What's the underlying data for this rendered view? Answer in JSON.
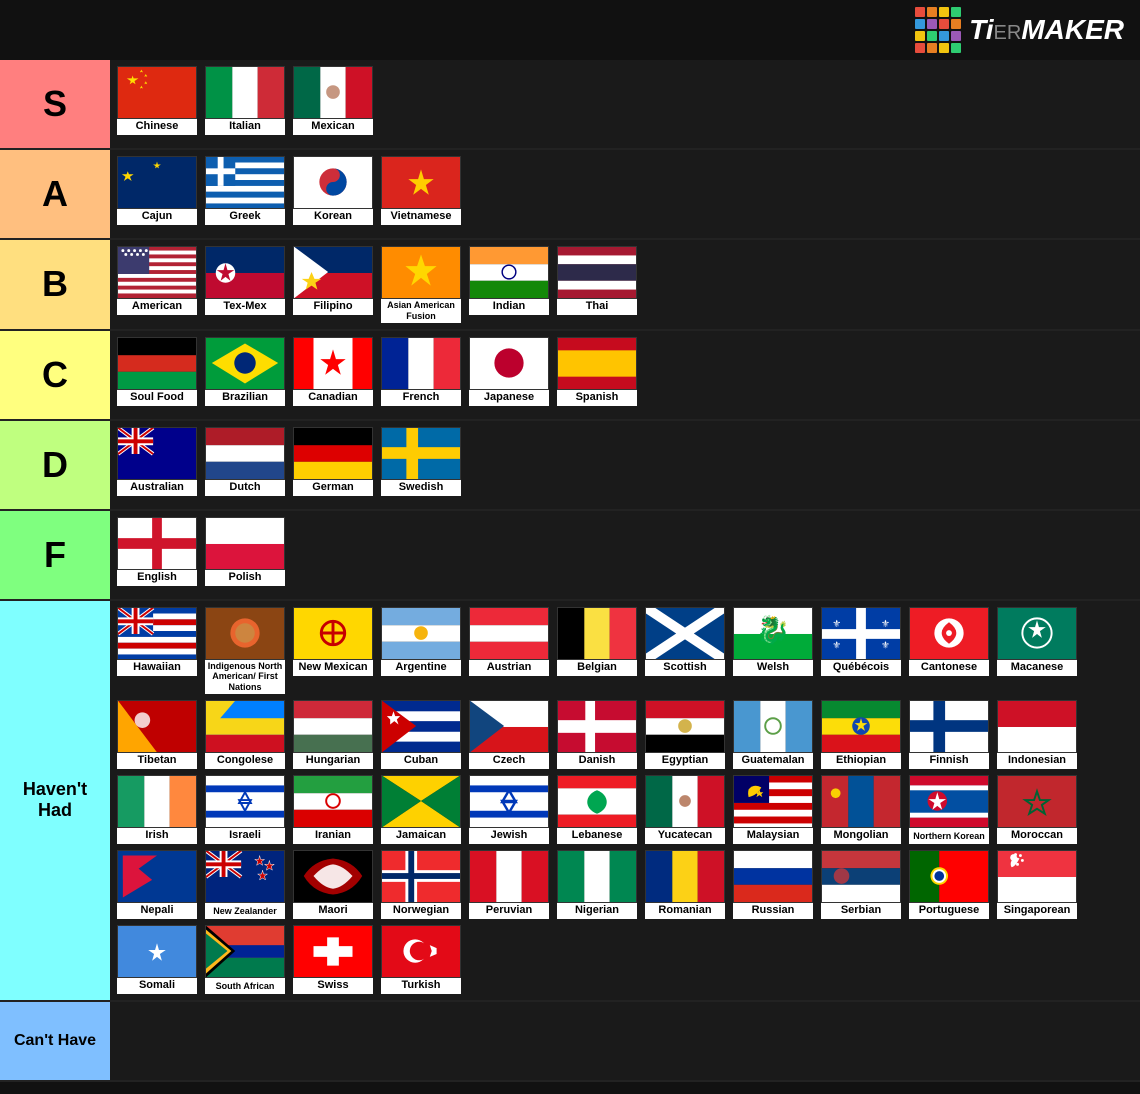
{
  "header": {
    "logo_text": "TiERMAKER"
  },
  "tiers": [
    {
      "id": "s",
      "label": "S",
      "color": "#ff7f7f",
      "items": [
        {
          "name": "Chinese",
          "flag": "china"
        },
        {
          "name": "Italian",
          "flag": "italy"
        },
        {
          "name": "Mexican",
          "flag": "mexico"
        }
      ]
    },
    {
      "id": "a",
      "label": "A",
      "color": "#ffbf7f",
      "items": [
        {
          "name": "Cajun",
          "flag": "cajun"
        },
        {
          "name": "Greek",
          "flag": "greek"
        },
        {
          "name": "Korean",
          "flag": "korean"
        },
        {
          "name": "Vietnamese",
          "flag": "vietnamese"
        }
      ]
    },
    {
      "id": "b",
      "label": "B",
      "color": "#ffdf7f",
      "items": [
        {
          "name": "American",
          "flag": "american"
        },
        {
          "name": "Tex-Mex",
          "flag": "texmex"
        },
        {
          "name": "Filipino",
          "flag": "filipino"
        },
        {
          "name": "Asian American Fusion",
          "flag": "asianfusion"
        },
        {
          "name": "Indian",
          "flag": "indian"
        },
        {
          "name": "Thai",
          "flag": "thai"
        }
      ]
    },
    {
      "id": "c",
      "label": "C",
      "color": "#ffff7f",
      "items": [
        {
          "name": "Soul Food",
          "flag": "soulfood"
        },
        {
          "name": "Brazilian",
          "flag": "brazilian"
        },
        {
          "name": "Canadian",
          "flag": "canadian"
        },
        {
          "name": "French",
          "flag": "french"
        },
        {
          "name": "Japanese",
          "flag": "japanese"
        },
        {
          "name": "Spanish",
          "flag": "spanish"
        }
      ]
    },
    {
      "id": "d",
      "label": "D",
      "color": "#bfff7f",
      "items": [
        {
          "name": "Australian",
          "flag": "australian"
        },
        {
          "name": "Dutch",
          "flag": "dutch"
        },
        {
          "name": "German",
          "flag": "german"
        },
        {
          "name": "Swedish",
          "flag": "swedish"
        }
      ]
    },
    {
      "id": "f",
      "label": "F",
      "color": "#7fff7f",
      "items": [
        {
          "name": "English",
          "flag": "english"
        },
        {
          "name": "Polish",
          "flag": "polish"
        }
      ]
    },
    {
      "id": "havent",
      "label": "Haven't Had",
      "color": "#7fffff",
      "items": [
        {
          "name": "Hawaiian",
          "flag": "hawaiian"
        },
        {
          "name": "Indigenous North American/ First Nations",
          "flag": "indigenous"
        },
        {
          "name": "New Mexican",
          "flag": "newmexican"
        },
        {
          "name": "Argentine",
          "flag": "argentine"
        },
        {
          "name": "Austrian",
          "flag": "austrian"
        },
        {
          "name": "Belgian",
          "flag": "belgian"
        },
        {
          "name": "Scottish",
          "flag": "scottish"
        },
        {
          "name": "Welsh",
          "flag": "welsh"
        },
        {
          "name": "Québécois",
          "flag": "quebecois"
        },
        {
          "name": "Cantonese",
          "flag": "cantonese"
        },
        {
          "name": "Macanese",
          "flag": "macanese"
        },
        {
          "name": "Tibetan",
          "flag": "tibetan"
        },
        {
          "name": "Congolese",
          "flag": "congolese"
        },
        {
          "name": "Hungarian",
          "flag": "hungarian"
        },
        {
          "name": "Cuban",
          "flag": "cuban"
        },
        {
          "name": "Czech",
          "flag": "czech"
        },
        {
          "name": "Danish",
          "flag": "danish"
        },
        {
          "name": "Egyptian",
          "flag": "egyptian"
        },
        {
          "name": "Guatemalan",
          "flag": "guatemalan"
        },
        {
          "name": "Ethiopian",
          "flag": "ethiopian"
        },
        {
          "name": "Finnish",
          "flag": "finnish"
        },
        {
          "name": "Indonesian",
          "flag": "indonesian"
        },
        {
          "name": "Irish",
          "flag": "irish"
        },
        {
          "name": "Israeli",
          "flag": "israeli"
        },
        {
          "name": "Iranian",
          "flag": "iranian"
        },
        {
          "name": "Jamaican",
          "flag": "jamaican"
        },
        {
          "name": "Jewish",
          "flag": "jewish"
        },
        {
          "name": "Lebanese",
          "flag": "lebanese"
        },
        {
          "name": "Yucatecan",
          "flag": "yucatecan"
        },
        {
          "name": "Malaysian",
          "flag": "malaysian"
        },
        {
          "name": "Mongolian",
          "flag": "mongolian"
        },
        {
          "name": "Northern Korean",
          "flag": "northkorean"
        },
        {
          "name": "Moroccan",
          "flag": "moroccan"
        },
        {
          "name": "Nepali",
          "flag": "nepali"
        },
        {
          "name": "New Zealander",
          "flag": "newzealand"
        },
        {
          "name": "Maori",
          "flag": "maori"
        },
        {
          "name": "Norwegian",
          "flag": "norwegian"
        },
        {
          "name": "Peruvian",
          "flag": "peruvian"
        },
        {
          "name": "Nigerian",
          "flag": "nigerian"
        },
        {
          "name": "Romanian",
          "flag": "romanian"
        },
        {
          "name": "Russian",
          "flag": "russian"
        },
        {
          "name": "Serbian",
          "flag": "serbian"
        },
        {
          "name": "Portuguese",
          "flag": "portuguese"
        },
        {
          "name": "Singaporean",
          "flag": "singaporean"
        },
        {
          "name": "Somali",
          "flag": "somali"
        },
        {
          "name": "South African",
          "flag": "southafrican"
        },
        {
          "name": "Swiss",
          "flag": "swiss"
        },
        {
          "name": "Turkish",
          "flag": "turkish"
        }
      ]
    },
    {
      "id": "cant",
      "label": "Can't Have",
      "color": "#7fbfff",
      "items": []
    }
  ]
}
